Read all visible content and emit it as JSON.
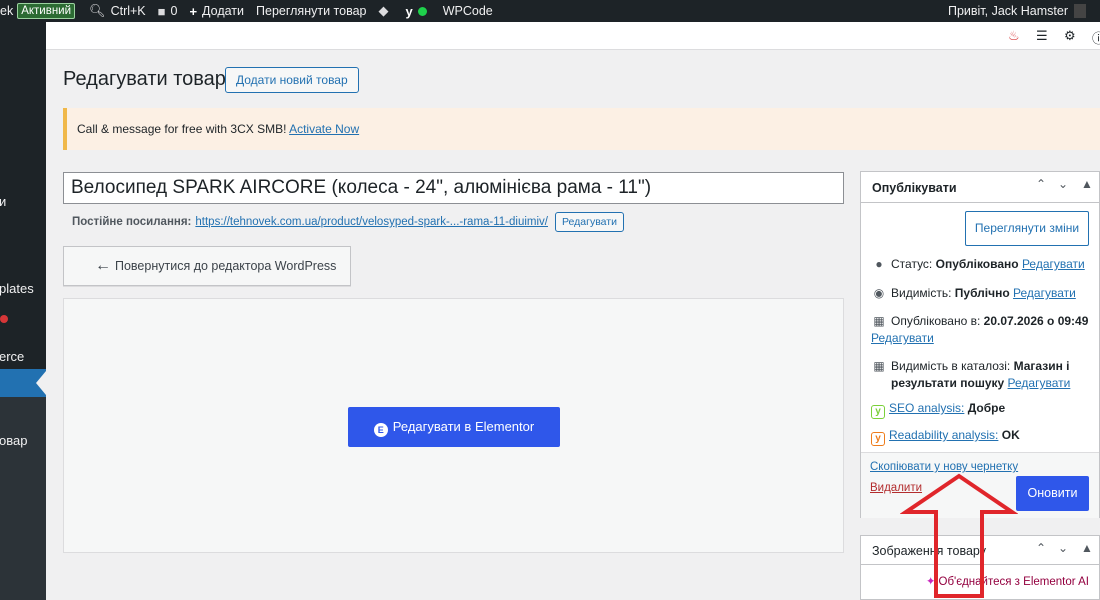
{
  "adminbar": {
    "site_name_partial": "ek",
    "status_badge": "Активний",
    "search_shortcut": "Ctrl+K",
    "comments_count": "0",
    "add_new": "Додати",
    "view_product": "Переглянути товар",
    "wpcode": "WPCode",
    "greeting": "Привіт, Jack Hamster"
  },
  "sidebar": {
    "items": [
      {
        "label": "и"
      },
      {
        "label": "plates"
      },
      {
        "label": "erce"
      },
      {
        "label": "овар"
      }
    ]
  },
  "header": {
    "title": "Редагувати товар",
    "add_new_button": "Додати новий товар"
  },
  "notice": {
    "text": "Call & message for free with 3CX SMB!",
    "link": "Activate Now"
  },
  "post": {
    "title": "Велосипед SPARK AIRCORE (колеса - 24\", алюмінієва рама - 11\")",
    "permalink_label": "Постійне посилання:",
    "permalink_url": "https://tehnovek.com.ua/product/velosyped-spark-...-rama-11-diuimiv/",
    "permalink_edit": "Редагувати",
    "back_to_wp": "Повернутися до редактора WordPress",
    "elementor_button": "Редагувати в Elementor"
  },
  "publish": {
    "title": "Опублікувати",
    "preview_button": "Переглянути зміни",
    "status_label": "Статус:",
    "status_value": "Опубліковано",
    "status_edit": "Редагувати",
    "visibility_label": "Видимість:",
    "visibility_value": "Публічно",
    "visibility_edit": "Редагувати",
    "published_label": "Опубліковано в:",
    "published_value": "20.07.2026 о 09:49",
    "published_edit": "Редагувати",
    "catalog_label": "Видимість в каталозі:",
    "catalog_value_line1": "Магазин і",
    "catalog_value_line2": "результати пошуку",
    "catalog_edit": "Редагувати",
    "seo_label": "SEO analysis:",
    "seo_value": "Добре",
    "readability_label": "Readability analysis:",
    "readability_value": "OK",
    "copy_draft": "Скопіювати у нову чернетку",
    "delete": "Видалити",
    "update_button": "Оновити"
  },
  "image_box": {
    "title": "Зображення товару",
    "ai_link": "Об'єднайтеся з Elementor AI"
  },
  "colors": {
    "accent": "#2271b1",
    "elementor_blue": "#2f57ea",
    "annotation_red": "#e0262b"
  },
  "icons": {
    "search": "search-icon",
    "comment": "comment-icon",
    "plus": "plus-icon",
    "pin": "pin-icon",
    "eye": "eye-icon",
    "calendar": "calendar-icon",
    "grid": "grid-icon"
  }
}
